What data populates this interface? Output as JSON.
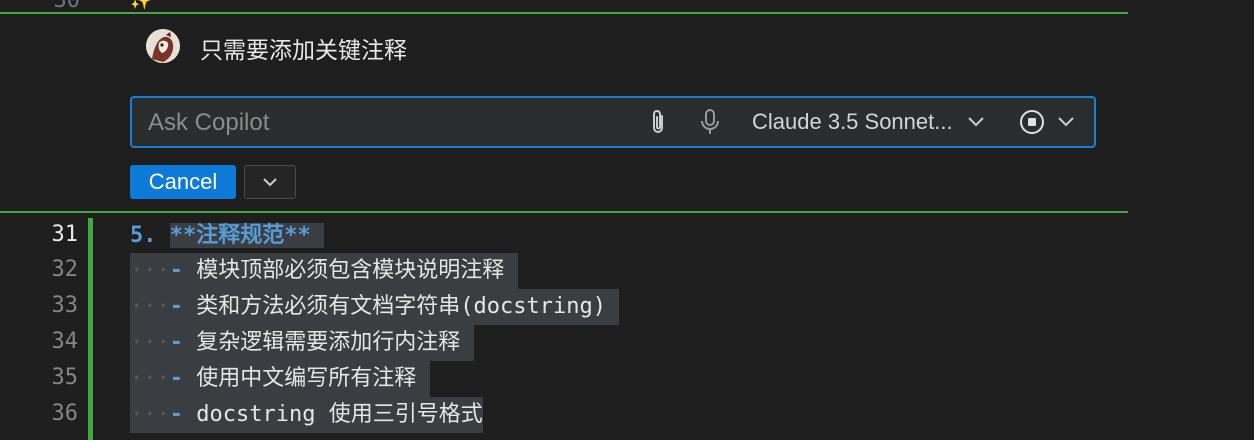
{
  "editor_top": {
    "partial_line_number": "30",
    "sparkle_glyph": "✨"
  },
  "chat": {
    "message": "只需要添加关键注释",
    "input": {
      "placeholder": "Ask Copilot",
      "value": ""
    },
    "model": {
      "label": "Claude 3.5 Sonnet..."
    },
    "cancel_label": "Cancel"
  },
  "editor": {
    "lines": [
      {
        "number": "31",
        "prefix": "5.",
        "text": "**注释规范**"
      },
      {
        "number": "32",
        "indent": "···",
        "dash": "-",
        "text": "模块顶部必须包含模块说明注释"
      },
      {
        "number": "33",
        "indent": "···",
        "dash": "-",
        "text": "类和方法必须有文档字符串(docstring)"
      },
      {
        "number": "34",
        "indent": "···",
        "dash": "-",
        "text": "复杂逻辑需要添加行内注释"
      },
      {
        "number": "35",
        "indent": "···",
        "dash": "-",
        "text": "使用中文编写所有注释"
      },
      {
        "number": "36",
        "indent": "···",
        "dash": "-",
        "text": "docstring 使用三引号格式"
      }
    ]
  },
  "colors": {
    "accent": "#0e7ad8",
    "diff_green": "#3fa83f",
    "focus_border": "#1a7fd4",
    "markdown_blue": "#569cd6"
  },
  "icons": [
    "avatar",
    "paperclip-icon",
    "microphone-icon",
    "chevron-down-icon",
    "stop-circle-icon",
    "chevron-down-icon"
  ]
}
